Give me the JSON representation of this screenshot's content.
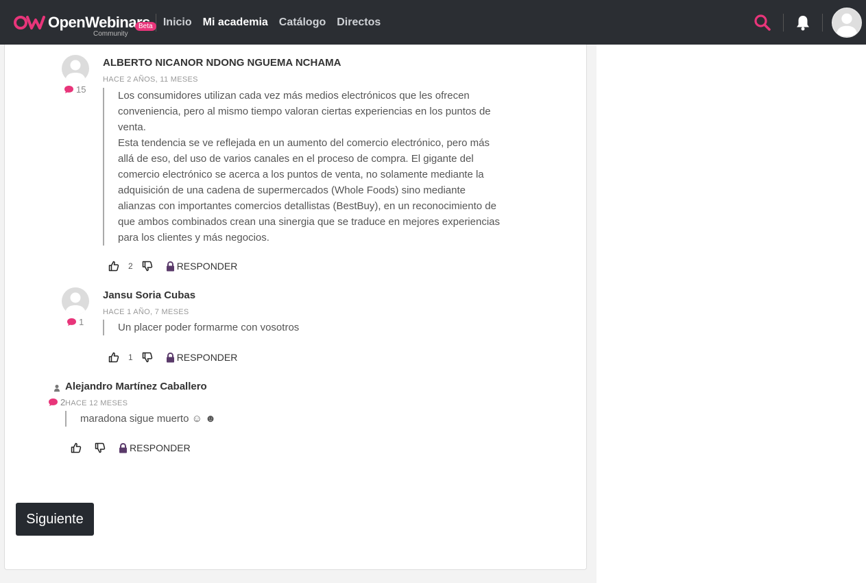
{
  "header": {
    "brand_name": "OpenWebinars",
    "brand_badge": "Beta",
    "brand_sub": "Community",
    "nav": [
      {
        "label": "Inicio",
        "active": false
      },
      {
        "label": "Mi academia",
        "active": true
      },
      {
        "label": "Catálogo",
        "active": false
      },
      {
        "label": "Directos",
        "active": false
      }
    ],
    "accent": "#e8357a"
  },
  "comments": [
    {
      "author": "ALBERTO NICANOR NDONG NGUEMA NCHAMA",
      "date": "HACE 2 AÑOS, 11 MESES",
      "comment_count": "15",
      "paragraphs": [
        "Los consumidores utilizan cada vez más medios electrónicos que les ofrecen conveniencia, pero al mismo tiempo valoran ciertas experiencias en los puntos de venta.",
        "Esta tendencia se ve reflejada en un aumento del comercio electrónico, pero más allá de eso, del uso de varios canales en el proceso de compra. El gigante del comercio electrónico se acerca a los puntos de venta, no solamente mediante la adquisición de una cadena de supermercados (Whole Foods) sino mediante alianzas con importantes comercios detallistas (BestBuy), en un reconocimiento de que ambos combinados crean una sinergia que se traduce en mejores experiencias para los clientes y más negocios."
      ],
      "likes": "2",
      "reply_label": "RESPONDER"
    },
    {
      "author": "Jansu Soria Cubas",
      "date": "HACE 1 AÑO, 7 MESES",
      "comment_count": "1",
      "paragraphs": [
        "Un placer poder formarme con vosotros"
      ],
      "likes": "1",
      "reply_label": "RESPONDER"
    },
    {
      "author": "Alejandro Martínez Caballero",
      "date": "HACE 12 MESES",
      "comment_count": "2",
      "paragraphs": [
        "maradona sigue muerto ☺ ☻"
      ],
      "likes": "",
      "reply_label": "RESPONDER"
    }
  ],
  "pagination": {
    "next_label": "Siguiente"
  }
}
